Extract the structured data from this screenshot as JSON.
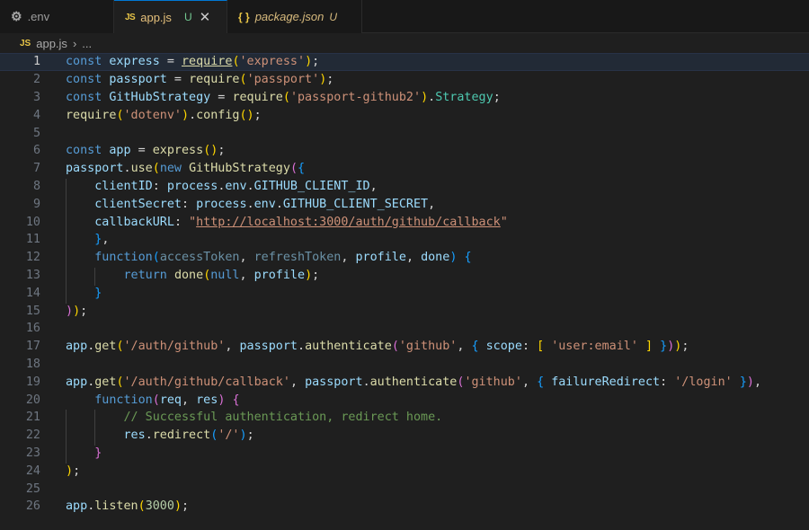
{
  "tabs": [
    {
      "label": ".env",
      "icon": "gear-icon",
      "glyph": "⚙"
    },
    {
      "label": "app.js",
      "icon": "js-icon",
      "glyph": "JS",
      "modified": "U",
      "close": "✕"
    },
    {
      "label": "package.json",
      "icon": "json-icon",
      "glyph": "{ }",
      "modified": "U"
    }
  ],
  "breadcrumb": {
    "icon_glyph": "JS",
    "file": "app.js",
    "separator": "›",
    "more": "..."
  },
  "editor": {
    "current_line": 1,
    "lines": [
      {
        "n": "1",
        "t": [
          [
            "k",
            "const"
          ],
          [
            "p",
            " "
          ],
          [
            "v",
            "express"
          ],
          [
            "p",
            " = "
          ],
          [
            "f u",
            "require"
          ],
          [
            "b1",
            "("
          ],
          [
            "s",
            "'express'"
          ],
          [
            "b1",
            ")"
          ],
          [
            "p",
            ";"
          ]
        ]
      },
      {
        "n": "2",
        "t": [
          [
            "k",
            "const"
          ],
          [
            "p",
            " "
          ],
          [
            "v",
            "passport"
          ],
          [
            "p",
            " = "
          ],
          [
            "f",
            "require"
          ],
          [
            "b1",
            "("
          ],
          [
            "s",
            "'passport'"
          ],
          [
            "b1",
            ")"
          ],
          [
            "p",
            ";"
          ]
        ]
      },
      {
        "n": "3",
        "t": [
          [
            "k",
            "const"
          ],
          [
            "p",
            " "
          ],
          [
            "v",
            "GitHubStrategy"
          ],
          [
            "p",
            " = "
          ],
          [
            "f",
            "require"
          ],
          [
            "b1",
            "("
          ],
          [
            "s",
            "'passport-github2'"
          ],
          [
            "b1",
            ")"
          ],
          [
            "p",
            "."
          ],
          [
            "t",
            "Strategy"
          ],
          [
            "p",
            ";"
          ]
        ]
      },
      {
        "n": "4",
        "t": [
          [
            "f",
            "require"
          ],
          [
            "b1",
            "("
          ],
          [
            "s",
            "'dotenv'"
          ],
          [
            "b1",
            ")"
          ],
          [
            "p",
            "."
          ],
          [
            "f",
            "config"
          ],
          [
            "b1",
            "()"
          ],
          [
            "p",
            ";"
          ]
        ]
      },
      {
        "n": "5",
        "t": []
      },
      {
        "n": "6",
        "t": [
          [
            "k",
            "const"
          ],
          [
            "p",
            " "
          ],
          [
            "v",
            "app"
          ],
          [
            "p",
            " = "
          ],
          [
            "f",
            "express"
          ],
          [
            "b1",
            "()"
          ],
          [
            "p",
            ";"
          ]
        ]
      },
      {
        "n": "7",
        "t": [
          [
            "v",
            "passport"
          ],
          [
            "p",
            "."
          ],
          [
            "f",
            "use"
          ],
          [
            "b1",
            "("
          ],
          [
            "k",
            "new"
          ],
          [
            "p",
            " "
          ],
          [
            "f",
            "GitHubStrategy"
          ],
          [
            "b2",
            "("
          ],
          [
            "b3",
            "{"
          ]
        ]
      },
      {
        "n": "8",
        "t": [
          [
            "p",
            "    "
          ],
          [
            "v",
            "clientID"
          ],
          [
            "p",
            ": "
          ],
          [
            "v",
            "process"
          ],
          [
            "p",
            "."
          ],
          [
            "v",
            "env"
          ],
          [
            "p",
            "."
          ],
          [
            "v",
            "GITHUB_CLIENT_ID"
          ],
          [
            "p",
            ","
          ]
        ]
      },
      {
        "n": "9",
        "t": [
          [
            "p",
            "    "
          ],
          [
            "v",
            "clientSecret"
          ],
          [
            "p",
            ": "
          ],
          [
            "v",
            "process"
          ],
          [
            "p",
            "."
          ],
          [
            "v",
            "env"
          ],
          [
            "p",
            "."
          ],
          [
            "v",
            "GITHUB_CLIENT_SECRET"
          ],
          [
            "p",
            ","
          ]
        ]
      },
      {
        "n": "10",
        "t": [
          [
            "p",
            "    "
          ],
          [
            "v",
            "callbackURL"
          ],
          [
            "p",
            ": "
          ],
          [
            "s",
            "\""
          ],
          [
            "s u",
            "http://localhost:3000/auth/github/callback"
          ],
          [
            "s",
            "\""
          ]
        ]
      },
      {
        "n": "11",
        "t": [
          [
            "p",
            "    "
          ],
          [
            "b3",
            "}"
          ],
          [
            "p",
            ","
          ]
        ]
      },
      {
        "n": "12",
        "t": [
          [
            "p",
            "    "
          ],
          [
            "k",
            "function"
          ],
          [
            "b3",
            "("
          ],
          [
            "pa",
            "accessToken"
          ],
          [
            "p",
            ", "
          ],
          [
            "pa",
            "refreshToken"
          ],
          [
            "p",
            ", "
          ],
          [
            "v",
            "profile"
          ],
          [
            "p",
            ", "
          ],
          [
            "v",
            "done"
          ],
          [
            "b3",
            ")"
          ],
          [
            "p",
            " "
          ],
          [
            "b3",
            "{"
          ]
        ]
      },
      {
        "n": "13",
        "t": [
          [
            "p",
            "        "
          ],
          [
            "k",
            "return"
          ],
          [
            "p",
            " "
          ],
          [
            "f",
            "done"
          ],
          [
            "b1",
            "("
          ],
          [
            "k",
            "null"
          ],
          [
            "p",
            ", "
          ],
          [
            "v",
            "profile"
          ],
          [
            "b1",
            ")"
          ],
          [
            "p",
            ";"
          ]
        ]
      },
      {
        "n": "14",
        "t": [
          [
            "p",
            "    "
          ],
          [
            "b3",
            "}"
          ]
        ]
      },
      {
        "n": "15",
        "t": [
          [
            "b2",
            ")"
          ],
          [
            "b1",
            ")"
          ],
          [
            "p",
            ";"
          ]
        ]
      },
      {
        "n": "16",
        "t": []
      },
      {
        "n": "17",
        "t": [
          [
            "v",
            "app"
          ],
          [
            "p",
            "."
          ],
          [
            "f",
            "get"
          ],
          [
            "b1",
            "("
          ],
          [
            "s",
            "'/auth/github'"
          ],
          [
            "p",
            ", "
          ],
          [
            "v",
            "passport"
          ],
          [
            "p",
            "."
          ],
          [
            "f",
            "authenticate"
          ],
          [
            "b2",
            "("
          ],
          [
            "s",
            "'github'"
          ],
          [
            "p",
            ", "
          ],
          [
            "b3",
            "{"
          ],
          [
            "p",
            " "
          ],
          [
            "v",
            "scope"
          ],
          [
            "p",
            ": "
          ],
          [
            "b1",
            "["
          ],
          [
            "p",
            " "
          ],
          [
            "s",
            "'user:email'"
          ],
          [
            "p",
            " "
          ],
          [
            "b1",
            "]"
          ],
          [
            "p",
            " "
          ],
          [
            "b3",
            "}"
          ],
          [
            "b2",
            ")"
          ],
          [
            "b1",
            ")"
          ],
          [
            "p",
            ";"
          ]
        ]
      },
      {
        "n": "18",
        "t": []
      },
      {
        "n": "19",
        "t": [
          [
            "v",
            "app"
          ],
          [
            "p",
            "."
          ],
          [
            "f",
            "get"
          ],
          [
            "b1",
            "("
          ],
          [
            "s",
            "'/auth/github/callback'"
          ],
          [
            "p",
            ", "
          ],
          [
            "v",
            "passport"
          ],
          [
            "p",
            "."
          ],
          [
            "f",
            "authenticate"
          ],
          [
            "b2",
            "("
          ],
          [
            "s",
            "'github'"
          ],
          [
            "p",
            ", "
          ],
          [
            "b3",
            "{"
          ],
          [
            "p",
            " "
          ],
          [
            "v",
            "failureRedirect"
          ],
          [
            "p",
            ": "
          ],
          [
            "s",
            "'/login'"
          ],
          [
            "p",
            " "
          ],
          [
            "b3",
            "}"
          ],
          [
            "b2",
            ")"
          ],
          [
            "p",
            ","
          ]
        ]
      },
      {
        "n": "20",
        "t": [
          [
            "p",
            "    "
          ],
          [
            "k",
            "function"
          ],
          [
            "b2",
            "("
          ],
          [
            "v",
            "req"
          ],
          [
            "p",
            ", "
          ],
          [
            "v",
            "res"
          ],
          [
            "b2",
            ")"
          ],
          [
            "p",
            " "
          ],
          [
            "b2",
            "{"
          ]
        ]
      },
      {
        "n": "21",
        "t": [
          [
            "p",
            "        "
          ],
          [
            "c",
            "// Successful authentication, redirect home."
          ]
        ]
      },
      {
        "n": "22",
        "t": [
          [
            "p",
            "        "
          ],
          [
            "v",
            "res"
          ],
          [
            "p",
            "."
          ],
          [
            "f",
            "redirect"
          ],
          [
            "b3",
            "("
          ],
          [
            "s",
            "'/'"
          ],
          [
            "b3",
            ")"
          ],
          [
            "p",
            ";"
          ]
        ]
      },
      {
        "n": "23",
        "t": [
          [
            "p",
            "    "
          ],
          [
            "b2",
            "}"
          ]
        ]
      },
      {
        "n": "24",
        "t": [
          [
            "b1",
            ")"
          ],
          [
            "p",
            ";"
          ]
        ]
      },
      {
        "n": "25",
        "t": []
      },
      {
        "n": "26",
        "t": [
          [
            "v",
            "app"
          ],
          [
            "p",
            "."
          ],
          [
            "f",
            "listen"
          ],
          [
            "b1",
            "("
          ],
          [
            "n",
            "3000"
          ],
          [
            "b1",
            ")"
          ],
          [
            "p",
            ";"
          ]
        ]
      }
    ]
  }
}
